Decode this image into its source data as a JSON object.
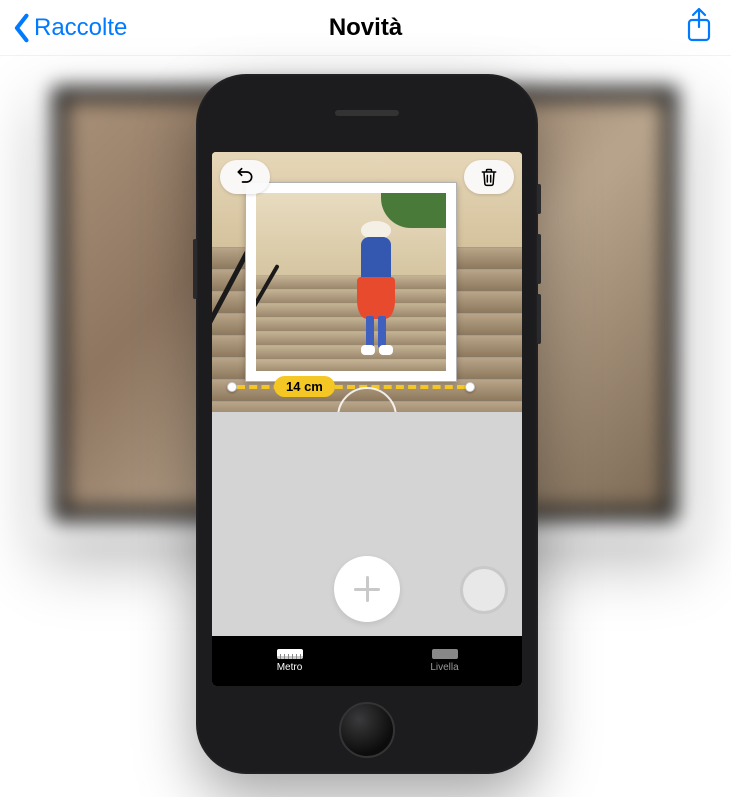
{
  "nav": {
    "back_label": "Raccolte",
    "title": "Novità"
  },
  "measure": {
    "value": "14 cm"
  },
  "tabs": {
    "metro": "Metro",
    "livella": "Livella"
  }
}
